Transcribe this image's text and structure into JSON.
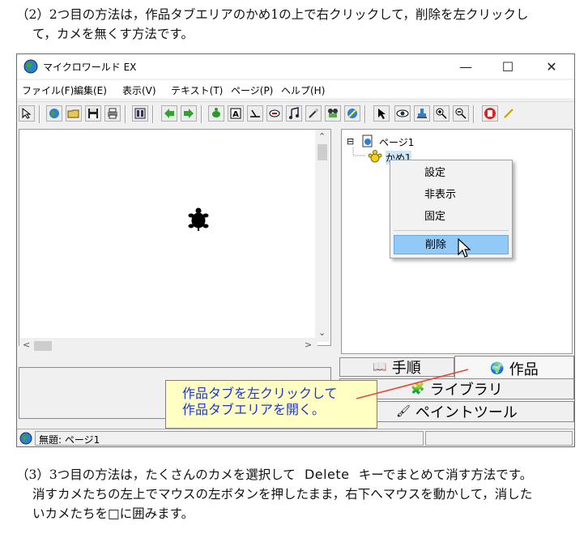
{
  "intro": {
    "line1": "（2）2つ目の方法は，作品タブエリアのかめ1の上で右クリックして，削除を左クリックし",
    "line2": "て，カメを無くす方法です。"
  },
  "window": {
    "title": "マイクロワールド EX",
    "controls": {
      "minimize": "—",
      "maximize": "☐",
      "close": "✕"
    },
    "menu": [
      "ファイル(F)",
      "編集(E)",
      "表示(V)",
      "テキスト(T)",
      "ページ(P)",
      "ヘルプ(H)"
    ],
    "tree": {
      "page": "ページ1",
      "turtle": "かめ1",
      "expander": "⊟"
    },
    "context_menu": [
      "設定",
      "非表示",
      "固定",
      "削除"
    ],
    "tabs": {
      "steps": "手順",
      "works": "作品",
      "library": "ライブラリ",
      "paint": "ペイントツール"
    },
    "callout": {
      "line1": "作品タブを左クリックして",
      "line2": "作品タブエリアを開く。"
    },
    "status": {
      "title": "無題: ページ1"
    }
  },
  "outro": {
    "line1_a": "（3）3つ目の方法は，たくさんのカメを選択して",
    "line1_key": "Delete",
    "line1_b": "キーでまとめて消す方法です。",
    "line2": "消すカメたちの左上でマウスの左ボタンを押したまま，右下へマウスを動かして，消した",
    "line3": "いカメたちを□に囲みます。"
  },
  "colors": {
    "callout_text": "#1a35d6",
    "callout_bg": "#ffffc4",
    "highlight": "#91c9f7"
  }
}
